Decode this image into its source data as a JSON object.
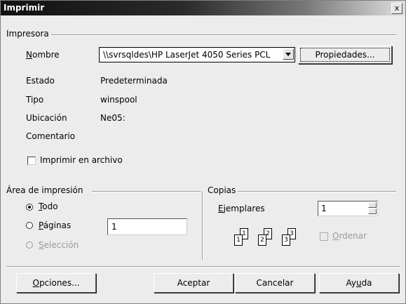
{
  "window": {
    "title": "Imprimir",
    "close_glyph": "x"
  },
  "printer": {
    "group_label": "Impresora",
    "name_label": "Nombre",
    "name_value": "\\\\svrsqldes\\HP LaserJet 4050 Series PCL",
    "properties_button": "Propiedades...",
    "status_label": "Estado",
    "status_value": "Predeterminada",
    "type_label": "Tipo",
    "type_value": "winspool",
    "location_label": "Ubicación",
    "location_value": "Ne05:",
    "comment_label": "Comentario",
    "print_to_file_label": "Imprimir en archivo",
    "print_to_file_checked": false
  },
  "print_range": {
    "group_label": "Área de impresión",
    "all_label": "Todo",
    "pages_label": "Páginas",
    "pages_value": "1",
    "selection_label": "Selección",
    "selected": "all"
  },
  "copies": {
    "group_label": "Copias",
    "copies_label": "Ejemplares",
    "copies_value": "1",
    "collate_label": "Ordenar",
    "collate_enabled": false,
    "page_numbers": [
      "1",
      "1",
      "2",
      "2",
      "3",
      "3"
    ]
  },
  "buttons": {
    "options": "Opciones...",
    "ok": "Aceptar",
    "cancel": "Cancelar",
    "help": "Ayuda"
  },
  "icons": {
    "close": "close-icon",
    "dropdown": "chevron-down-icon",
    "spin_up": "arrow-up-icon",
    "spin_down": "arrow-down-icon",
    "collate": "collate-pages-icon"
  }
}
